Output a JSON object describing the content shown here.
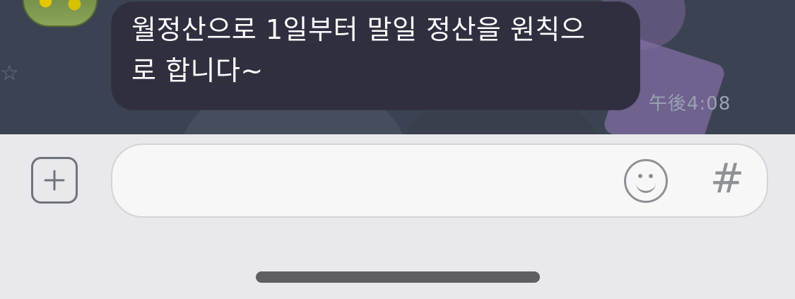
{
  "chat": {
    "message_text": "월정산으로 1일부터 말일 정산을 원칙으\n로 합니다~",
    "timestamp": "午後4:08"
  },
  "composer": {
    "add_button_label": "+",
    "hashtag_label": "#"
  },
  "icons": {
    "add": "plus-icon",
    "emoji": "smiley-icon",
    "hashtag": "hashtag-icon"
  }
}
